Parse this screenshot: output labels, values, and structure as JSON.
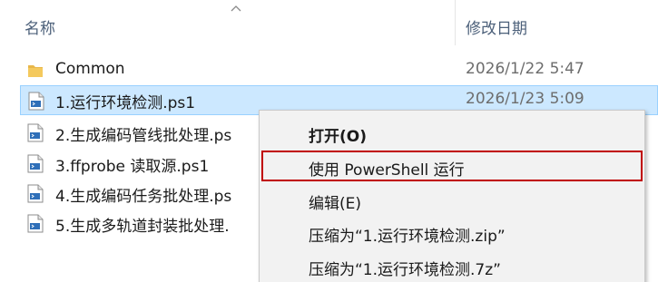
{
  "header": {
    "name_col": "名称",
    "date_col": "修改日期"
  },
  "files": [
    {
      "name": "Common",
      "date": "2026/1/22 5:47",
      "icon": "folder-icon",
      "selected": false
    },
    {
      "name": "1.运行环境检测.ps1",
      "date": "2026/1/23 5:09",
      "icon": "powershell-script-icon",
      "selected": true
    },
    {
      "name": "2.生成编码管线批处理.ps",
      "date": "",
      "icon": "powershell-script-icon",
      "selected": false
    },
    {
      "name": "3.ffprobe 读取源.ps1",
      "date": "",
      "icon": "powershell-script-icon",
      "selected": false
    },
    {
      "name": "4.生成编码任务批处理.ps",
      "date": "",
      "icon": "powershell-script-icon",
      "selected": false
    },
    {
      "name": "5.生成多轨道封装批处理.",
      "date": "",
      "icon": "powershell-script-icon",
      "selected": false
    }
  ],
  "context_menu": {
    "items": [
      {
        "label": "打开(O)",
        "bold": true,
        "highlighted": false
      },
      {
        "label": "使用 PowerShell 运行",
        "bold": false,
        "highlighted": true
      },
      {
        "label": "编辑(E)",
        "bold": false,
        "highlighted": false
      },
      {
        "label": "压缩为“1.运行环境检测.zip”",
        "bold": false,
        "highlighted": false
      },
      {
        "label": "压缩为“1.运行环境检测.7z”",
        "bold": false,
        "highlighted": false
      }
    ]
  },
  "colors": {
    "selection_bg": "#cce8ff",
    "selection_border": "#99d1ff",
    "highlight_border": "#c00000",
    "header_text": "#4c607a"
  }
}
